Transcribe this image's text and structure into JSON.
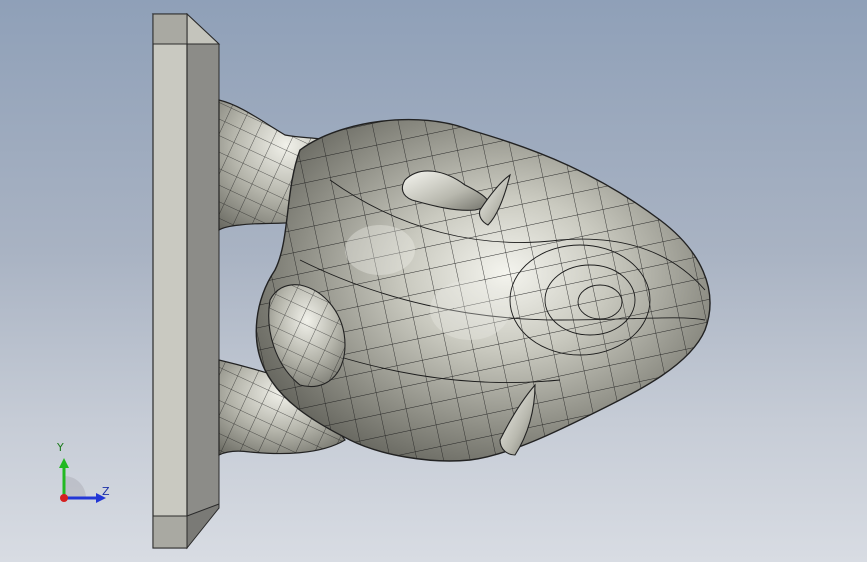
{
  "viewport": {
    "background_top": "#8fa0b8",
    "background_bottom": "#d8dce3"
  },
  "model": {
    "surface_color": "#b9b9ae",
    "mesh_line_color": "#1a1a1a",
    "base_plate_face_color": "#c9c9c0",
    "base_plate_side_color": "#8f8f8a"
  },
  "triad": {
    "y_label": "Y",
    "z_label": "Z",
    "y_color": "#22b922",
    "z_color": "#2236d6",
    "x_color": "#d42020",
    "icon": "view-orientation-triad"
  }
}
